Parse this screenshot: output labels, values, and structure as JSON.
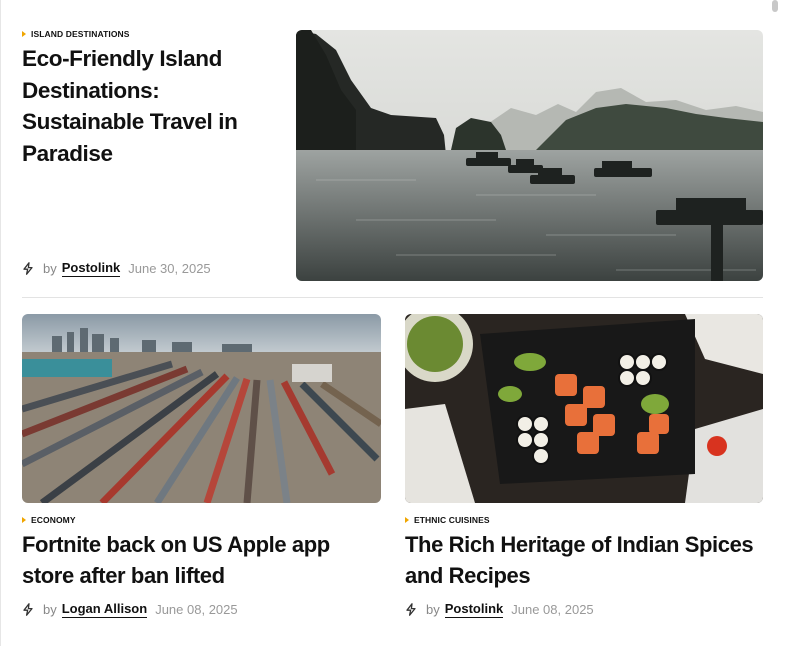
{
  "featured": {
    "category": "ISLAND DESTINATIONS",
    "title": "Eco-Friendly Island Destinations: Sustainable Travel in Paradise",
    "by": "by",
    "author": "Postolink",
    "date": "June 30, 2025",
    "image": "island-boats-photo"
  },
  "cards": [
    {
      "category": "ECONOMY",
      "title": "Fortnite back on US Apple app store after ban lifted",
      "by": "by",
      "author": "Logan Allison",
      "date": "June 08, 2025",
      "image": "rail-yard-photo"
    },
    {
      "category": "ETHNIC CUISINES",
      "title": "The Rich Heritage of Indian Spices and Recipes",
      "by": "by",
      "author": "Postolink",
      "date": "June 08, 2025",
      "image": "sushi-platter-photo"
    }
  ],
  "colors": {
    "accent": "#f0a500",
    "text": "#111111",
    "muted": "#999999"
  }
}
